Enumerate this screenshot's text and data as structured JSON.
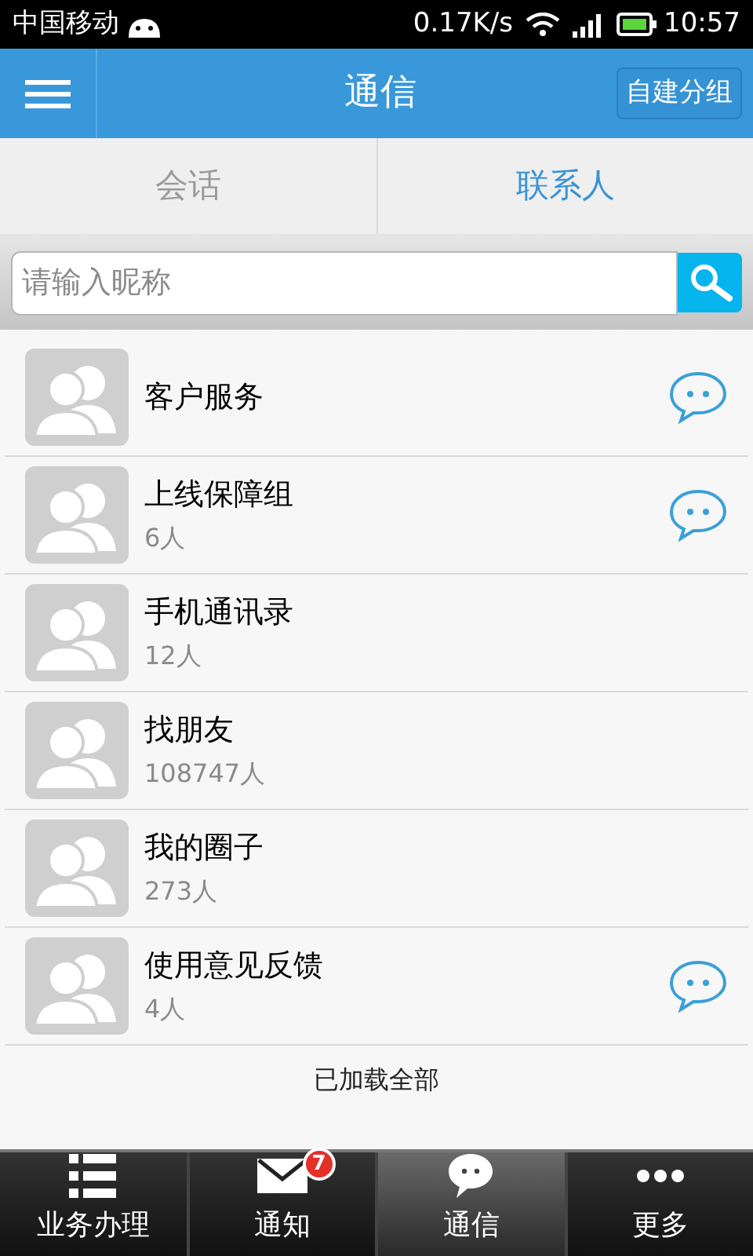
{
  "status_bar": {
    "carrier": "中国移动",
    "speed": "0.17K/s",
    "time": "10:57"
  },
  "header": {
    "title": "通信",
    "action": "自建分组"
  },
  "tabs": [
    {
      "label": "会话",
      "selected": false
    },
    {
      "label": "联系人",
      "selected": true
    }
  ],
  "search": {
    "placeholder": "请输入昵称"
  },
  "contacts": [
    {
      "name": "客户服务",
      "chat": true
    },
    {
      "name": "上线保障组",
      "count": "6人",
      "chat": true
    },
    {
      "name": "手机通讯录",
      "count": "12人",
      "chat": false
    },
    {
      "name": "找朋友",
      "count": "108747人",
      "chat": false
    },
    {
      "name": "我的圈子",
      "count": "273人",
      "chat": false
    },
    {
      "name": "使用意见反馈",
      "count": "4人",
      "chat": true
    }
  ],
  "list_footer": "已加载全部",
  "bottom_nav": [
    {
      "kind": "list",
      "label": "业务办理",
      "selected": false
    },
    {
      "kind": "mail",
      "label": "通知",
      "badge": "7",
      "selected": false
    },
    {
      "kind": "chat",
      "label": "通信",
      "selected": true
    },
    {
      "kind": "more",
      "label": "更多",
      "selected": false
    }
  ]
}
